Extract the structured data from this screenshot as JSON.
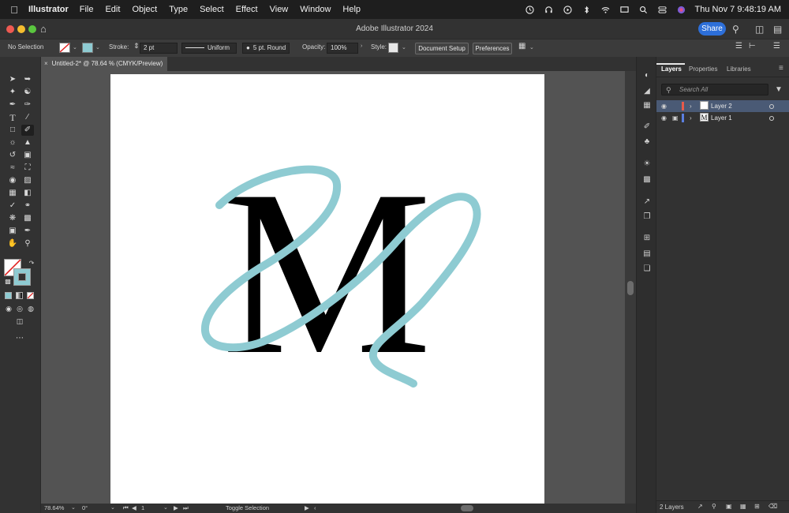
{
  "menubar": {
    "app_name": "Illustrator",
    "items": [
      "File",
      "Edit",
      "Object",
      "Type",
      "Select",
      "Effect",
      "View",
      "Window",
      "Help"
    ],
    "clock": "Thu Nov 7  9:48:19 AM"
  },
  "titlebar": {
    "title": "Adobe Illustrator 2024",
    "share_label": "Share"
  },
  "controlbar": {
    "selection": "No Selection",
    "stroke_label": "Stroke:",
    "stroke_value": "2 pt",
    "stroke_profile": "Uniform",
    "brush": "5 pt. Round",
    "opacity_label": "Opacity:",
    "opacity_value": "100%",
    "style_label": "Style:",
    "document_setup": "Document Setup",
    "preferences": "Preferences"
  },
  "document": {
    "tab_title": "Untitled-2* @ 78.64 % (CMYK/Preview)",
    "close_glyph": "×"
  },
  "artwork": {
    "letter": "M",
    "letter_color": "#000000",
    "stroke_color": "#8ecbd2"
  },
  "statusbar": {
    "zoom": "78.64%",
    "rotation": "0°",
    "artboard_number": "1",
    "tool_hint": "Toggle Selection"
  },
  "panel": {
    "tabs": [
      "Layers",
      "Properties",
      "Libraries"
    ],
    "search_placeholder": "Search All",
    "layers": [
      {
        "name": "Layer 2",
        "color": "#e85a4a",
        "selected": true,
        "locked": false,
        "thumb": ""
      },
      {
        "name": "Layer 1",
        "color": "#5b7fe0",
        "selected": false,
        "locked": true,
        "thumb": "M"
      }
    ],
    "layer_count": "2 Layers"
  },
  "colors": {
    "accent": "#2d6fd9",
    "fill_swatch": "#8ecbd2",
    "selection_highlight": "#4a5a75"
  }
}
